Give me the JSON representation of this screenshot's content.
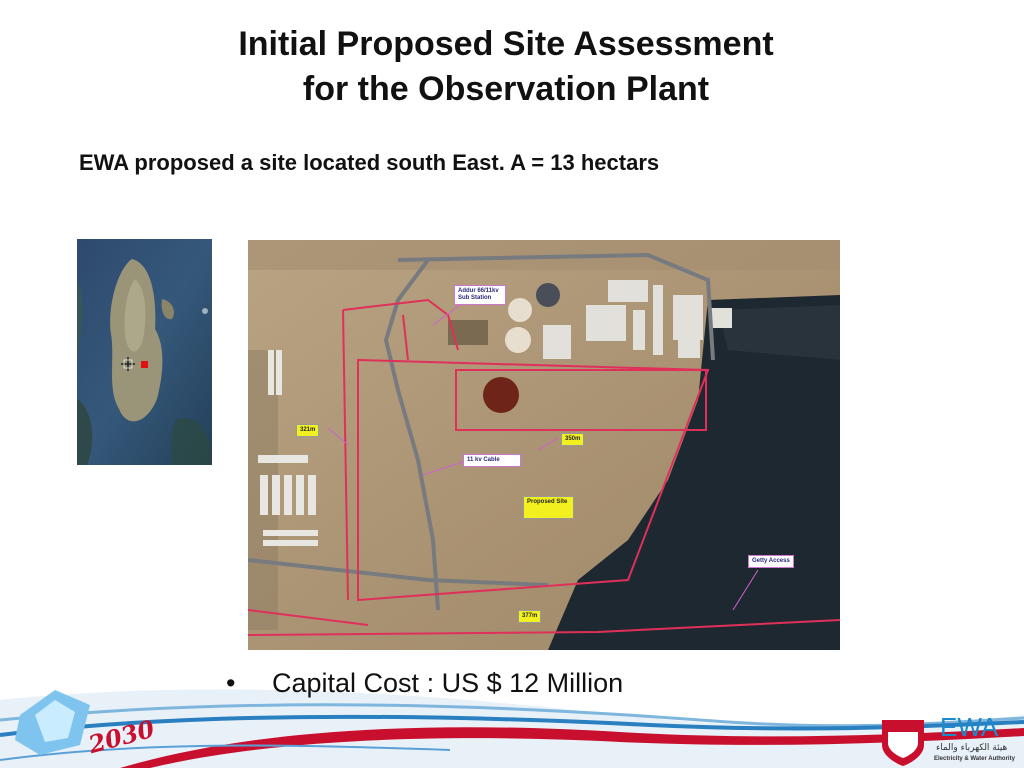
{
  "slide": {
    "title_line1": "Initial Proposed Site Assessment",
    "title_line2": "for the Observation Plant",
    "subtitle": "EWA proposed a site located south East. A = 13 hectars",
    "bullet": "Capital Cost : US $ 12 Million"
  },
  "map_labels": {
    "substation": "Addur 66/11kv Sub Station",
    "dist_321": "321m",
    "dist_350": "350m",
    "cable": "11 kv Cable",
    "proposed": "Proposed Site",
    "jetty": "Getty Access",
    "dist_377": "377m"
  },
  "footer": {
    "year_badge": "2030",
    "logo_text": "EWA",
    "logo_arabic": "هيئة الكهرباء والماء",
    "logo_english": "Electricity & Water Authority"
  },
  "colors": {
    "boundary": "#e0305a",
    "label_yellow": "#f3f020",
    "sea": "#1f2a33",
    "footer_red": "#c8102e",
    "footer_blue": "#2a7fc0"
  }
}
